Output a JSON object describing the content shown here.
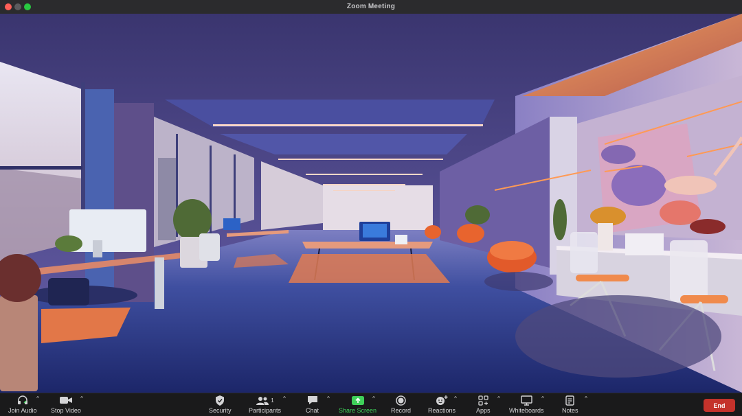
{
  "window": {
    "title": "Zoom Meeting"
  },
  "toolbar": {
    "join_audio": "Join Audio",
    "stop_video": "Stop Video",
    "security": "Security",
    "participants": "Participants",
    "participants_count": "1",
    "chat": "Chat",
    "share_screen": "Share Screen",
    "record": "Record",
    "reactions": "Reactions",
    "apps": "Apps",
    "whiteboards": "Whiteboards",
    "notes": "Notes",
    "end": "End"
  },
  "colors": {
    "share_green": "#3fd15a",
    "end_red": "#c4322b",
    "toolbar_bg": "#1a1a1b"
  },
  "icons": {
    "join_audio": "headphones-icon",
    "stop_video": "video-camera-icon",
    "security": "shield-icon",
    "participants": "people-icon",
    "chat": "speech-bubble-icon",
    "share_screen": "share-arrow-icon",
    "record": "record-icon",
    "reactions": "smile-plus-icon",
    "apps": "apps-icon",
    "whiteboards": "whiteboard-icon",
    "notes": "notes-icon"
  }
}
